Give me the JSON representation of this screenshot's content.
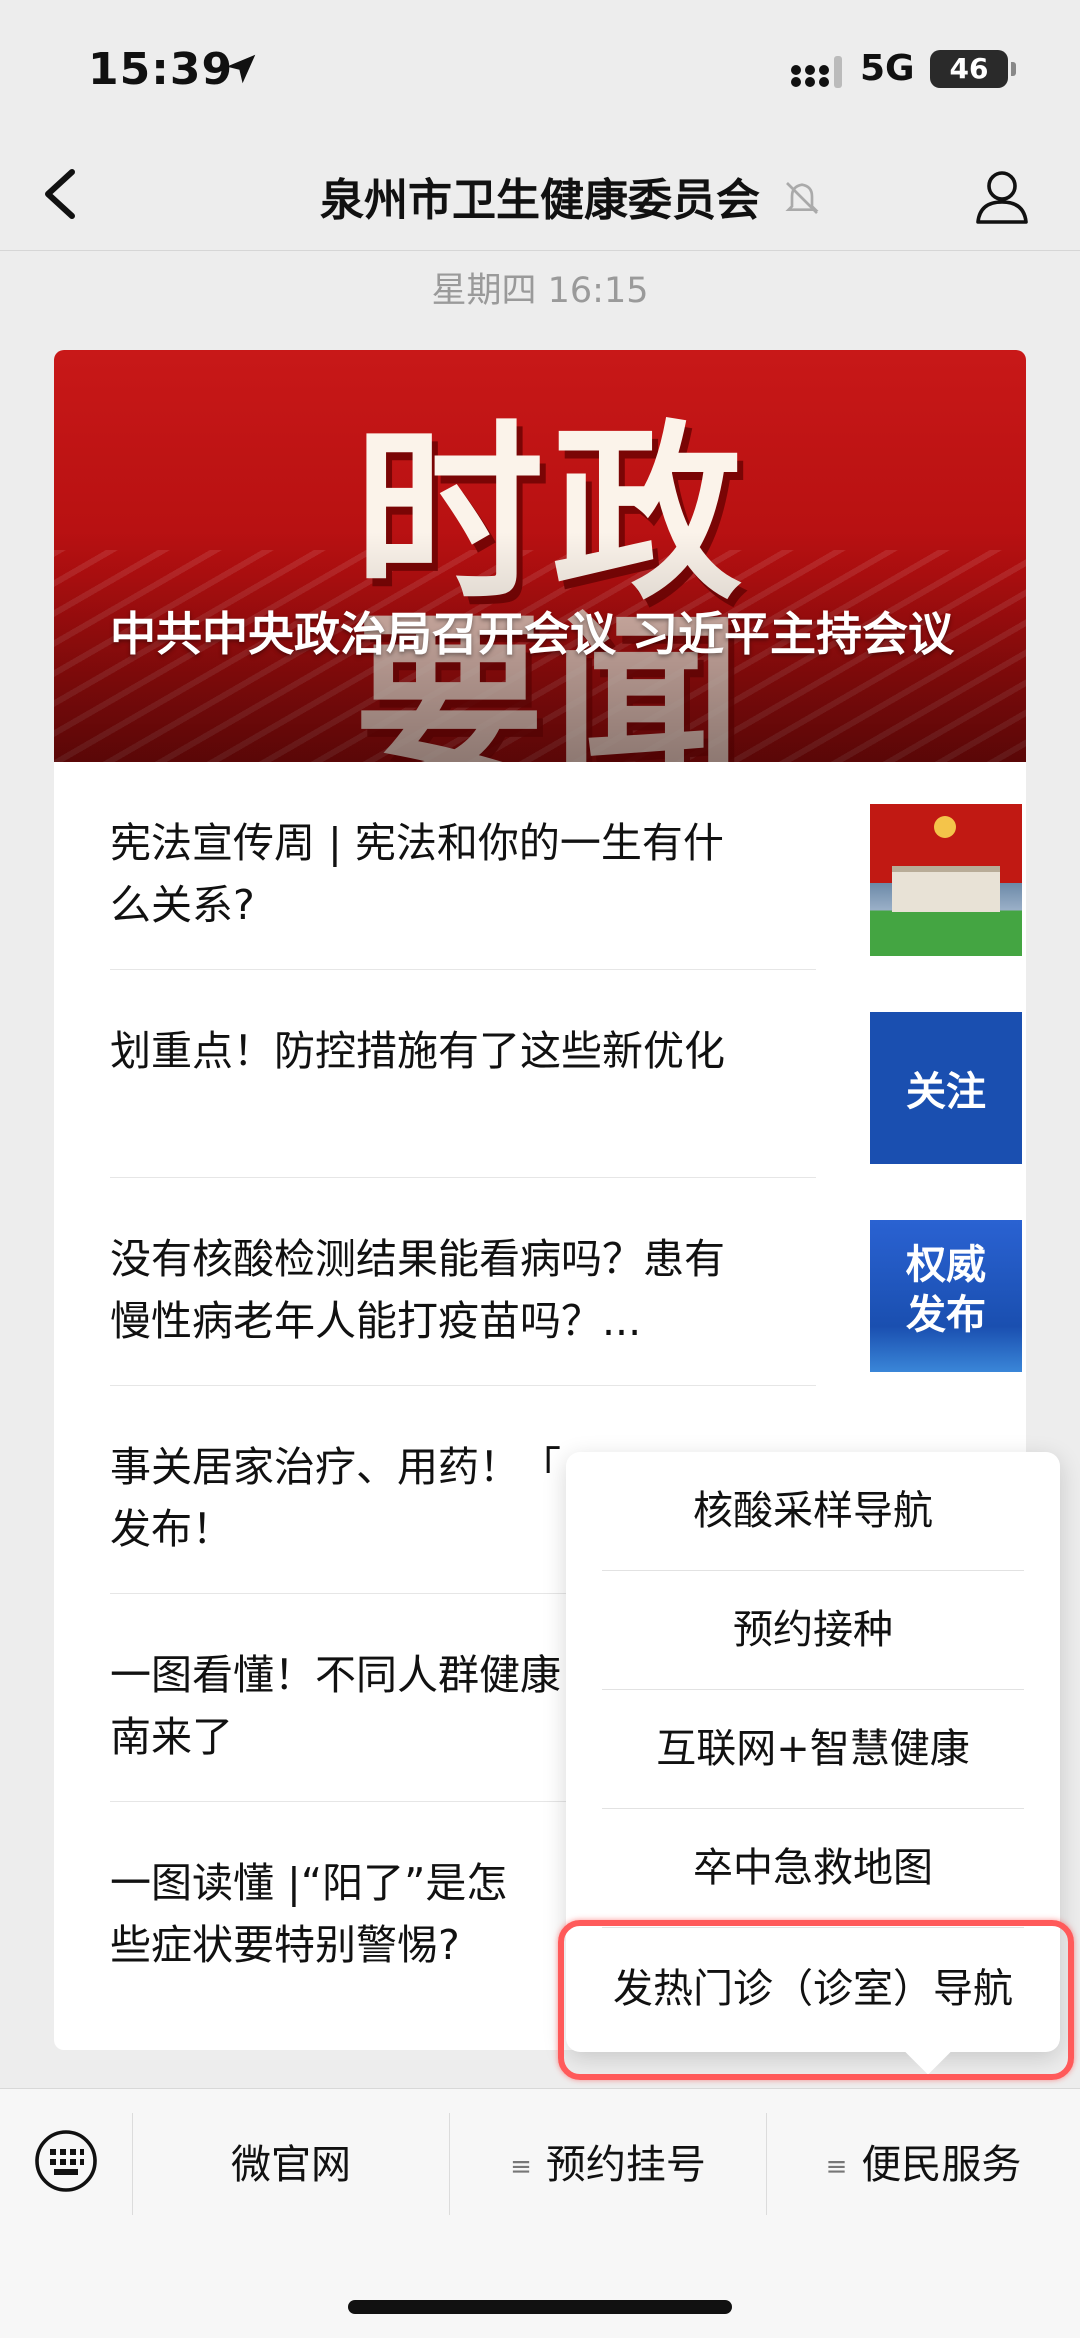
{
  "status_bar": {
    "time": "15:39",
    "network": "5G",
    "battery": "46"
  },
  "header": {
    "title": "泉州市卫生健康委员会"
  },
  "timestamp": "星期四 16:15",
  "banner": {
    "big_text_line1": "时政",
    "big_text_line2": "要闻",
    "headline": "中共中央政治局召开会议 习近平主持会议"
  },
  "articles": [
    {
      "title": "宪法宣传周 | 宪法和你的一生有什么关系?",
      "thumb_text": ""
    },
    {
      "title": "划重点！防控措施有了这些新优化",
      "thumb_text": "关注"
    },
    {
      "title": "没有核酸检测结果能看病吗？患有慢性病老年人能打疫苗吗？...",
      "thumb_text": "权威发布"
    },
    {
      "title": "事关居家治疗、用药！「",
      "title2": "发布！",
      "thumb_text": ""
    },
    {
      "title": "一图看懂！不同人群健康",
      "title2": "南来了",
      "thumb_text": ""
    },
    {
      "title": "一图读懂 |“阳了”是怎",
      "title2": "些症状要特别警惕?",
      "thumb_text": ""
    }
  ],
  "popup_menu": {
    "items": [
      "核酸采样导航",
      "预约接种",
      "互联网+智慧健康",
      "卒中急救地图",
      "发热门诊（诊室）导航"
    ]
  },
  "bottom_menu": {
    "items": [
      "微官网",
      "预约挂号",
      "便民服务"
    ]
  },
  "colors": {
    "highlight": "#ff5a5a",
    "banner_red": "#c81818",
    "thumb_blue": "#1a4fb0"
  }
}
